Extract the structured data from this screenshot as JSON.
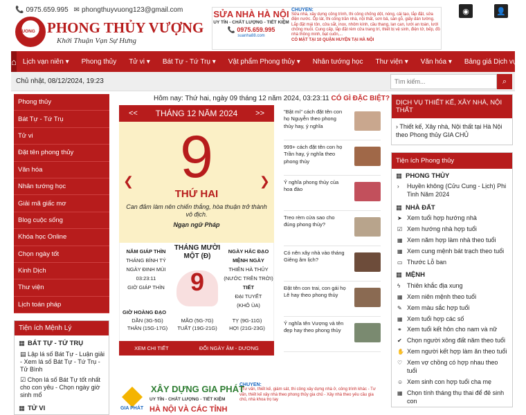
{
  "header": {
    "phone": "0975.659.995",
    "email": "phongthuyvuong123@gmail.com",
    "logo_small": "VUONG",
    "logo_title": "PHONG THỦY VƯỢNG",
    "logo_slogan": "Khởi Thuận Vạn Sự Hưng"
  },
  "banner": {
    "title": "SỬA NHÀ HÀ NỘI",
    "subtitle": "UY TÍN - CHẤT LƯỢNG - TIẾT KIỆM",
    "phone": "0975.659.995",
    "website": "suanha88.com",
    "right_heading": "CHUYÊN:",
    "right_text": "Sửa nhà, xây dựng công trình, thi công chống dột, nóng, cải tạo, lắp đặt, sửa điện nước. Ốp lát, thi công trần nhà, nội thất, sơn bả, sàn gỗ, giấy dán tường. Lắp đặt mái tôn, cửa sắt, inox, nhôm kính, cầu thang, lan can, lưới an toàn, lưới chống muỗi. Cung cấp, lắp đặt rèm cửa trang trí, thiết bị vệ sinh, điện tử, bếp, đồ nhà thông minh, bạt cuốn,...",
    "right_foot": "CÓ MẶT TẠI 10 QUẬN HUYỆN TẠI HÀ NỘI"
  },
  "icons": {
    "rss": "rss-icon",
    "user": "user-icon"
  },
  "nav": {
    "items": [
      "Lịch vạn niên ▾",
      "Phong thủy",
      "Tử vi ▾",
      "Bát Tự - Tứ Trụ ▾",
      "Vật phẩm Phong thủy ▾",
      "Nhân tướng học",
      "Thư viện ▾",
      "Văn hóa ▾",
      "Bảng giá Dịch vụ"
    ]
  },
  "date_line": "Chủ nhật, 08/12/2024, 19:23",
  "search": {
    "placeholder": "Tìm kiếm..."
  },
  "left_menu": [
    "Phong thủy",
    "Bát Tự - Tứ Trụ",
    "Tử vi",
    "Đặt tên phong thủy",
    "Văn hóa",
    "Nhân tướng học",
    "Giải mã giấc mơ",
    "Blog cuộc sống",
    "Khóa học Online",
    "Chọn ngày tốt",
    "Kinh Dịch",
    "Thư viện",
    "Lịch toán pháp"
  ],
  "left_util": {
    "heading": "Tiện ích Mệnh Lý",
    "sec1": "BÁT TỰ - TỨ TRỤ",
    "link1": "Lập lá số Bát Tự - Luận giải - Xem lá số Bát Tự - Tứ Trụ - Tử Bình",
    "link2": "Chọn lá số Bát Tự tốt nhất cho con yêu - Chọn ngày giờ sinh mổ",
    "sec2": "TỬ VI"
  },
  "today": {
    "text": "Hôm nay: Thứ hai, ngày 09 tháng 12 năm 2024, 03:23:11",
    "special": "CÓ GÌ ĐẶC BIỆT?"
  },
  "calendar": {
    "prev": "<<",
    "month_title": "THÁNG 12 NĂM 2024",
    "next": ">>",
    "day": "9",
    "weekday": "THỨ HAI",
    "quote": "Can đảm làm nên chiến thắng, hòa thuận trở thành vô địch.",
    "author": "Ngạn ngữ Pháp",
    "left_col": [
      "NĂM GIÁP THÌN",
      "THÁNG BÍNH TÝ",
      "NGÀY ĐINH MÙI",
      "03:23:11",
      "GIỜ GIÁP THÌN"
    ],
    "lunar_month": "THÁNG MƯỜI MỘT (Đ)",
    "lunar_day": "9",
    "right_col": [
      "NGÀY HẮC ĐẠO",
      "MỆNH NGÀY",
      "THIÊN HÀ THỦY",
      "(NƯỚC TRÊN TRỜI)",
      "TIẾT",
      "ĐẠI TUYẾT",
      "(KHÔ ÙA)"
    ],
    "hoang_label": "GIỜ HOÀNG ĐẠO",
    "hoang_hours": [
      "DẦN (3G-5G)",
      "MÃO (5G-7G)",
      "TỴ (9G-11G)",
      "THÂN (15G-17G)",
      "TUẤT (19G-21G)",
      "HỢI (21G-23G)"
    ],
    "foot_left": "XEM CHI TIẾT",
    "foot_right": "ĐỔI NGÀY ÂM - DƯƠNG"
  },
  "news": [
    {
      "text": "\"Bật mí\" cách đặt tên con họ Nguyễn theo phong thủy hay, ý nghĩa",
      "color": "#c9a78e"
    },
    {
      "text": "999+ cách đặt tên con họ Trần hay, ý nghĩa theo phong thủy",
      "color": "#a06848"
    },
    {
      "text": "Ý nghĩa phong thủy của hoa đào",
      "color": "#c2505c"
    },
    {
      "text": "Treo rèm cửa sao cho đúng phong thủy?",
      "color": "#b8a48c"
    },
    {
      "text": "Có nên xây nhà vào tháng Giêng âm lịch?",
      "color": "#6d4c3a"
    },
    {
      "text": "Đặt tên con trai, con gái họ Lê hay theo phong thủy",
      "color": "#8a6a52"
    },
    {
      "text": "Ý nghĩa tên Vượng và tên đẹp hay theo phong thủy",
      "color": "#7a8a70"
    }
  ],
  "banner2": {
    "title": "XÂY DỰNG GIA PHÁT",
    "subtitle": "UY TÍN - CHẤT LƯỢNG - TIẾT KIỆM",
    "phone": "HÀ NỘI VÀ CÁC TỈNH",
    "logo_text": "GIA PHÁT",
    "right_heading": "CHUYÊN:",
    "right_text": "- Tư vấn, thiết kế, giám sát, thi công xây dựng nhà ở, công trình khác - Tư vấn, thiết kế xây nhà theo phong thủy gia chủ - Xây nhà theo yêu cầu gia chủ, nhà khoa trọ tay"
  },
  "right_box1": {
    "heading": "DỊCH VỤ THIẾT KẾ, XÂY NHÀ, NỘI THẤT",
    "body": "Thiết kế, Xây nhà, Nội thất tại Hà Nội theo Phong thủy GIA CHỦ"
  },
  "right_util": {
    "heading": "Tiện ích Phong thủy",
    "sec_phongthuy": "PHONG THỦY",
    "item_huyenkhong": "Huyền không (Cửu Cung - Lịch) Phi Tinh Năm 2024",
    "sec_nhadat": "NHÀ ĐẤT",
    "nhadat_items": [
      "Xem tuổi hợp hướng nhà",
      "Xem hướng nhà hợp tuổi",
      "Xem năm hợp làm nhà theo tuổi",
      "Xem cung mệnh bát trạch theo tuổi",
      "Thước Lỗ ban"
    ],
    "sec_menh": "MỆNH",
    "menh_items": [
      "Thiên khắc địa xung",
      "Xem niên mệnh theo tuổi",
      "Xem màu sắc hợp tuổi",
      "Xem tuổi hợp các số",
      "Xem tuổi kết hôn cho nam và nữ",
      "Chọn người xông đất năm theo tuổi",
      "Xem người kết hợp làm ăn theo tuổi",
      "Xem vợ chồng có hợp nhau theo tuổi",
      "Xem sinh con hợp tuổi cha mẹ",
      "Chọn tính tháng thụ thai để đẻ sinh con"
    ]
  }
}
